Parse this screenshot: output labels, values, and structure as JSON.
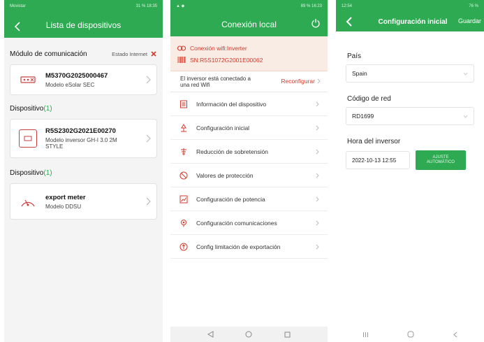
{
  "colors": {
    "accent": "#2daa52",
    "alert": "#d03a2b"
  },
  "phone1": {
    "status_left": "Movistar",
    "status_right": "31 % 18:35",
    "title": "Lista de dispositivos",
    "comm_section": {
      "title": "Módulo de comunicación",
      "status": "Estado Internet"
    },
    "comm_card": {
      "sn": "M5370G2025000467",
      "model": "Modelo  eSolar SEC"
    },
    "dev_section_1": {
      "label": "Dispositivo",
      "count": "(1)"
    },
    "inverter_card": {
      "sn": "R5S2302G2021E00270",
      "model_1": "Modelo inversor  GH-I 3.0 2M",
      "model_2": "STYLE"
    },
    "dev_section_2": {
      "label": "Dispositivo",
      "count": "(1)"
    },
    "meter_card": {
      "sn": "export meter",
      "model": "Modelo  DDSU"
    }
  },
  "phone2": {
    "status_right": "89 % 16:23",
    "title": "Conexión local",
    "wifi_conn": "Conexión wifi:Inverter",
    "sn": "SN:R5S1072G2001E00062",
    "wifi_msg": "El inversor está conectado a una red Wifi",
    "reconfig": "Reconfigurar",
    "menu": [
      {
        "label": "Información del dispositivo",
        "icon": "document-icon"
      },
      {
        "label": "Configuración inicial",
        "icon": "setup-icon"
      },
      {
        "label": "Reducción de sobretensión",
        "icon": "voltage-icon"
      },
      {
        "label": "Valores de protección",
        "icon": "protection-icon"
      },
      {
        "label": "Configuración de potencia",
        "icon": "power-chart-icon"
      },
      {
        "label": "Configuración comunicaciones",
        "icon": "antenna-icon"
      },
      {
        "label": "Config limitación de exportación",
        "icon": "export-limit-icon"
      }
    ]
  },
  "phone3": {
    "status_left": "12:54",
    "status_right": "76 %",
    "title": "Configuración inicial",
    "save": "Guardar",
    "country_label": "País",
    "country_value": "Spain",
    "grid_label": "Código de red",
    "grid_value": "RD1699",
    "time_label": "Hora del inversor",
    "time_value": "2022-10-13 12:55",
    "auto_btn": "AJUSTE AUTOMÁTICO"
  }
}
